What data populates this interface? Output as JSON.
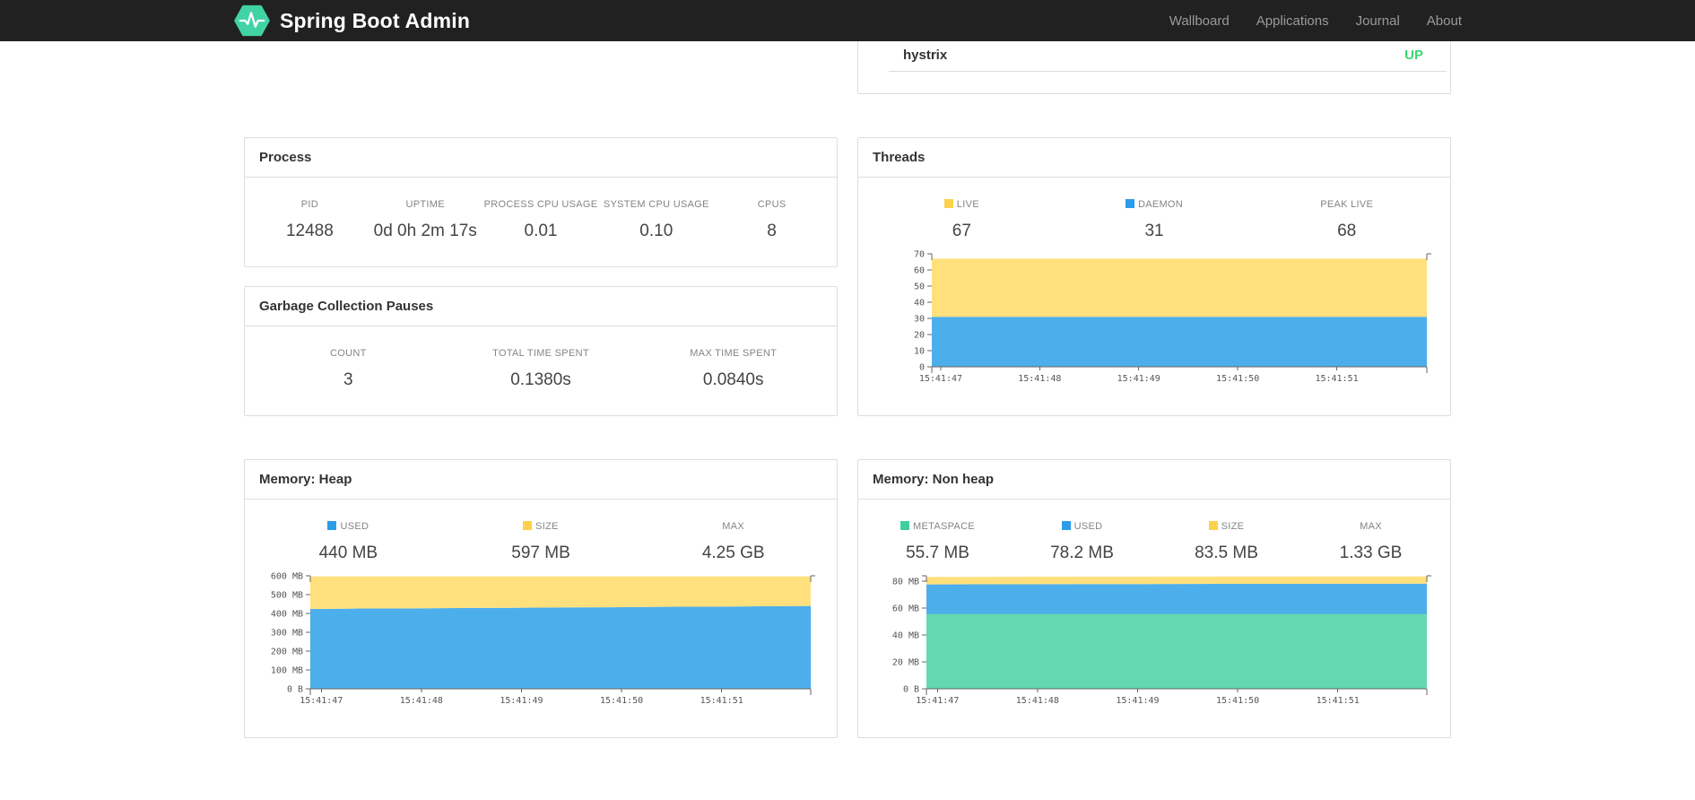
{
  "navbar": {
    "brand": "Spring Boot Admin",
    "links": [
      {
        "label": "Wallboard"
      },
      {
        "label": "Applications"
      },
      {
        "label": "Journal"
      },
      {
        "label": "About"
      }
    ]
  },
  "status_panel": {
    "application": "hystrix",
    "status": "UP",
    "status_color": "#3bd671"
  },
  "panels": {
    "process": {
      "title": "Process",
      "stats": [
        {
          "label": "PID",
          "value": "12488"
        },
        {
          "label": "UPTIME",
          "value": "0d 0h 2m 17s"
        },
        {
          "label": "PROCESS CPU USAGE",
          "value": "0.01"
        },
        {
          "label": "SYSTEM CPU USAGE",
          "value": "0.10"
        },
        {
          "label": "CPUS",
          "value": "8"
        }
      ]
    },
    "gc": {
      "title": "Garbage Collection Pauses",
      "stats": [
        {
          "label": "COUNT",
          "value": "3"
        },
        {
          "label": "TOTAL TIME SPENT",
          "value": "0.1380s"
        },
        {
          "label": "MAX TIME SPENT",
          "value": "0.0840s"
        }
      ]
    },
    "threads": {
      "title": "Threads",
      "stats": [
        {
          "label": "LIVE",
          "value": "67",
          "swatch": "#fcd24c"
        },
        {
          "label": "DAEMON",
          "value": "31",
          "swatch": "#2b9ce8"
        },
        {
          "label": "PEAK LIVE",
          "value": "68"
        }
      ]
    },
    "heap": {
      "title": "Memory: Heap",
      "stats": [
        {
          "label": "USED",
          "value": "440 MB",
          "swatch": "#2b9ce8"
        },
        {
          "label": "SIZE",
          "value": "597 MB",
          "swatch": "#fcd24c"
        },
        {
          "label": "MAX",
          "value": "4.25 GB"
        }
      ]
    },
    "nonheap": {
      "title": "Memory: Non heap",
      "stats": [
        {
          "label": "METASPACE",
          "value": "55.7 MB",
          "swatch": "#3fcf9f"
        },
        {
          "label": "USED",
          "value": "78.2 MB",
          "swatch": "#2b9ce8"
        },
        {
          "label": "SIZE",
          "value": "83.5 MB",
          "swatch": "#fcd24c"
        },
        {
          "label": "MAX",
          "value": "1.33 GB"
        }
      ]
    }
  },
  "chart_data": [
    {
      "id": "threads",
      "type": "area",
      "title": "Threads",
      "ylim": [
        0,
        70
      ],
      "yticks": [
        {
          "v": 0,
          "label": "0"
        },
        {
          "v": 10,
          "label": "10"
        },
        {
          "v": 20,
          "label": "20"
        },
        {
          "v": 30,
          "label": "30"
        },
        {
          "v": 40,
          "label": "40"
        },
        {
          "v": 50,
          "label": "50"
        },
        {
          "v": 60,
          "label": "60"
        },
        {
          "v": 70,
          "label": "70"
        }
      ],
      "x_labels": [
        "15:41:47",
        "15:41:48",
        "15:41:49",
        "15:41:50",
        "15:41:51"
      ],
      "x_tick_fracs": [
        0.018,
        0.218,
        0.418,
        0.618,
        0.818
      ],
      "series": [
        {
          "name": "DAEMON",
          "color": "#4daeec",
          "values": [
            31,
            31,
            31,
            31,
            31,
            31,
            31,
            31,
            31,
            31,
            31
          ]
        },
        {
          "name": "LIVE",
          "color": "#ffe07d",
          "values": [
            67,
            67,
            67,
            67,
            67,
            67,
            67,
            67,
            67,
            67,
            67
          ]
        }
      ]
    },
    {
      "id": "heap",
      "type": "area",
      "title": "Memory: Heap",
      "ylim": [
        0,
        600
      ],
      "yticks": [
        {
          "v": 0,
          "label": "0 B"
        },
        {
          "v": 100,
          "label": "100 MB"
        },
        {
          "v": 200,
          "label": "200 MB"
        },
        {
          "v": 300,
          "label": "300 MB"
        },
        {
          "v": 400,
          "label": "400 MB"
        },
        {
          "v": 500,
          "label": "500 MB"
        },
        {
          "v": 600,
          "label": "600 MB"
        }
      ],
      "x_labels": [
        "15:41:47",
        "15:41:48",
        "15:41:49",
        "15:41:50",
        "15:41:51"
      ],
      "x_tick_fracs": [
        0.022,
        0.222,
        0.422,
        0.622,
        0.822
      ],
      "series": [
        {
          "name": "USED",
          "color": "#4daeec",
          "values": [
            424,
            426,
            427,
            429,
            430,
            432,
            433,
            435,
            436,
            438,
            440
          ]
        },
        {
          "name": "SIZE",
          "color": "#ffe07d",
          "values": [
            597,
            597,
            597,
            597,
            597,
            597,
            597,
            597,
            597,
            597,
            597
          ]
        }
      ]
    },
    {
      "id": "nonheap",
      "type": "area",
      "title": "Memory: Non heap",
      "ylim": [
        0,
        84
      ],
      "yticks": [
        {
          "v": 0,
          "label": "0 B"
        },
        {
          "v": 20,
          "label": "20 MB"
        },
        {
          "v": 40,
          "label": "40 MB"
        },
        {
          "v": 60,
          "label": "60 MB"
        },
        {
          "v": 80,
          "label": "80 MB"
        }
      ],
      "x_labels": [
        "15:41:47",
        "15:41:48",
        "15:41:49",
        "15:41:50",
        "15:41:51"
      ],
      "x_tick_fracs": [
        0.022,
        0.222,
        0.422,
        0.622,
        0.822
      ],
      "series": [
        {
          "name": "METASPACE",
          "color": "#63d8b1",
          "values": [
            55.7,
            55.7,
            55.7,
            55.7,
            55.7,
            55.7,
            55.7,
            55.7,
            55.7,
            55.7,
            55.7
          ]
        },
        {
          "name": "USED",
          "color": "#4daeec",
          "values": [
            77.6,
            77.7,
            77.7,
            77.8,
            77.8,
            77.9,
            78.0,
            78.0,
            78.1,
            78.1,
            78.2
          ]
        },
        {
          "name": "SIZE",
          "color": "#ffe07d",
          "values": [
            83.2,
            83.2,
            83.3,
            83.3,
            83.3,
            83.4,
            83.4,
            83.4,
            83.5,
            83.5,
            83.5
          ]
        }
      ]
    }
  ],
  "colors": {
    "brand_green": "#42d3a5",
    "navbar_bg": "#212121",
    "panel_border": "#dddddd",
    "axis": "#666666"
  }
}
